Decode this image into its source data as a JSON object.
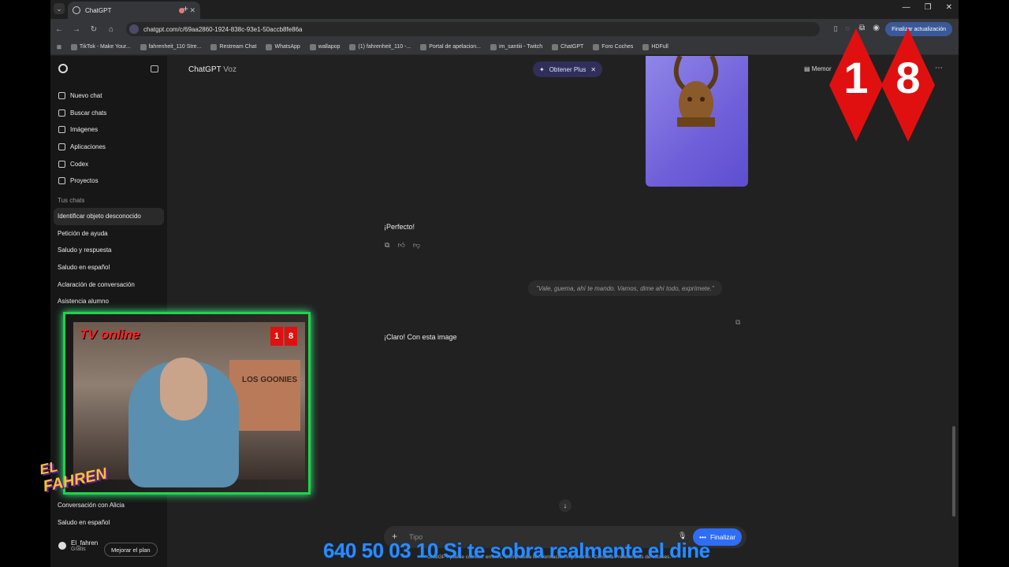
{
  "browser": {
    "tab_title": "ChatGPT",
    "url": "chatgpt.com/c/69aa2860-1924-838c-93e1-50accb8fe86a",
    "update_label": "Finalizar actualización",
    "bookmarks": [
      "TikTok - Make Your...",
      "fahrenheit_110 Stre...",
      "Restream Chat",
      "WhatsApp",
      "wallapop",
      "(1) fahrenheit_110 -...",
      "Portal de apelacion...",
      "im_santiii - Twitch",
      "ChatGPT",
      "Foro Coches",
      "HDFull"
    ]
  },
  "sidebar": {
    "nav": [
      {
        "label": "Nuevo chat",
        "icon": "edit-icon"
      },
      {
        "label": "Buscar chats",
        "icon": "search-icon"
      },
      {
        "label": "Imágenes",
        "icon": "image-icon"
      },
      {
        "label": "Aplicaciones",
        "icon": "apps-icon"
      },
      {
        "label": "Codex",
        "icon": "code-icon"
      },
      {
        "label": "Proyectos",
        "icon": "folder-icon"
      }
    ],
    "section_label": "Tus chats",
    "chats": [
      "Identificar objeto desconocido",
      "Petición de ayuda",
      "Saludo y respuesta",
      "Saludo en español",
      "Aclaración de conversación",
      "Asistencia alumno"
    ],
    "bottom_chats": [
      "Conversación con Alicia",
      "Saludo en español"
    ],
    "user_name": "El_fahren",
    "user_plan": "Gratis",
    "plan_button": "Mejorar el plan"
  },
  "main": {
    "model_name": "ChatGPT",
    "model_sub": "Voz",
    "plus_label": "Obtener Plus",
    "memory_label": "Memor",
    "message1": "¡Perfecto!",
    "voice_transcript": "\"Vale, guema, ahí te mando. Vamos, dime ahí todo, exprímete.\"",
    "message2": "¡Claro! Con esta image",
    "composer_placeholder": "Tipo",
    "finish_label": "Finalizar",
    "disclaimer": "ChatGPT puede cometer errores. Comprueba la información importante. Consulta Preferencias de cookies."
  },
  "overlay": {
    "ticker": "640 50 03 10 Si te sobra realmente el dine",
    "tv_label": "TV online",
    "poster_text": "LOS GOONIES",
    "fahren_el": "EL",
    "fahren_name": "FAHREN",
    "age_left": "1",
    "age_right": "8"
  }
}
